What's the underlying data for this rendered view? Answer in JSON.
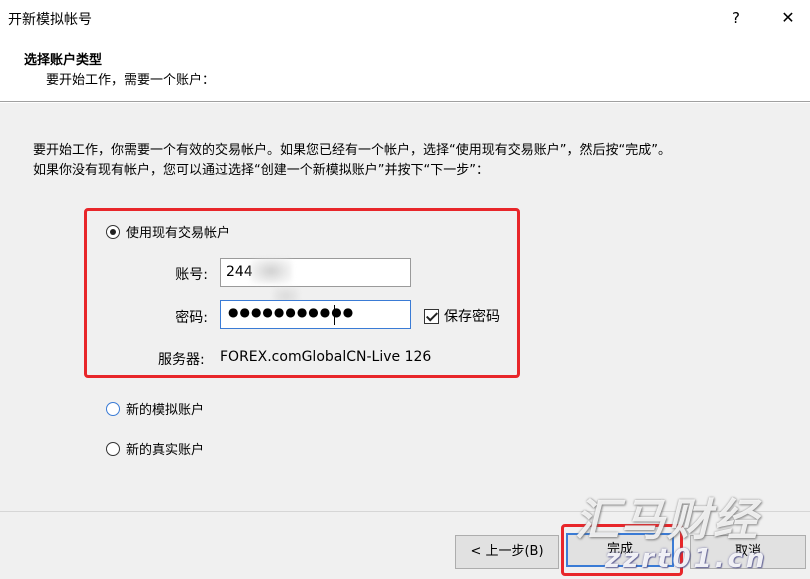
{
  "window": {
    "title": "开新模拟帐号",
    "help_label": "?",
    "close_label": "✕"
  },
  "header": {
    "title": "选择账户类型",
    "subtitle": "要开始工作，需要一个账户："
  },
  "intro": {
    "line1": "要开始工作，你需要一个有效的交易帐户。如果您已经有一个帐户，选择“使用现有交易账户”，然后按“完成”。",
    "line2": "如果你没有现有帐户，您可以通过选择“创建一个新模拟账户”并按下“下一步”："
  },
  "options": {
    "existing": {
      "label": "使用现有交易帐户",
      "selected": true
    },
    "demo": {
      "label": "新的模拟账户",
      "selected": false
    },
    "real": {
      "label": "新的真实账户",
      "selected": false
    }
  },
  "form": {
    "account_label": "账号:",
    "account_value": "244",
    "password_label": "密码:",
    "password_mask": "●●●●●●●●●●●",
    "save_password_label": "保存密码",
    "save_password_checked": true,
    "server_label": "服务器:",
    "server_value": "FOREX.comGlobalCN-Live 126"
  },
  "buttons": {
    "back": "< 上一步(B)",
    "finish": "完成",
    "cancel": "取消"
  },
  "watermark": {
    "brand": "汇马财经",
    "site": "zzrt01.cn"
  },
  "colors": {
    "highlight": "#e8262a",
    "focus": "#3a7bd5",
    "panel_bg": "#f0f0f0"
  }
}
